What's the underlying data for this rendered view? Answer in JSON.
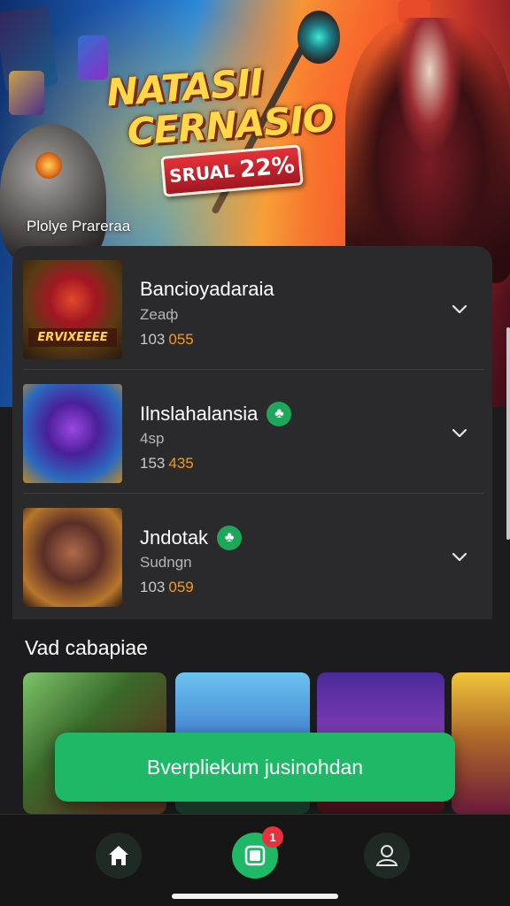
{
  "hero": {
    "title_line1": "NATASII",
    "title_line2": "CERNASIO",
    "badge_label": "SRUAL",
    "badge_value": "22%",
    "caption": "Plolye Prareraa"
  },
  "list": {
    "items": [
      {
        "name": "Bancioyadaraia",
        "subtitle": "Zeaф",
        "count": "103",
        "highlight": "055",
        "verified": false,
        "thumb_tag": "ERVIXEEEE"
      },
      {
        "name": "Ilnslahalansia",
        "subtitle": "4sp",
        "count": "153",
        "highlight": "435",
        "verified": true,
        "thumb_tag": ""
      },
      {
        "name": "Jndotak",
        "subtitle": "Sudngn",
        "count": "103",
        "highlight": "059",
        "verified": true,
        "thumb_tag": ""
      }
    ]
  },
  "section": {
    "title": "Vad cabapiae"
  },
  "cta": {
    "label": "Bverpliekum jusinohdan"
  },
  "bottom_nav": {
    "items": [
      "home-icon",
      "library-icon",
      "profile-icon"
    ],
    "badge_count": "1"
  },
  "colors": {
    "accent": "#1fb866",
    "highlight": "#f39a1e",
    "card_bg": "#2a2a2d",
    "badge": "#e5323e"
  }
}
